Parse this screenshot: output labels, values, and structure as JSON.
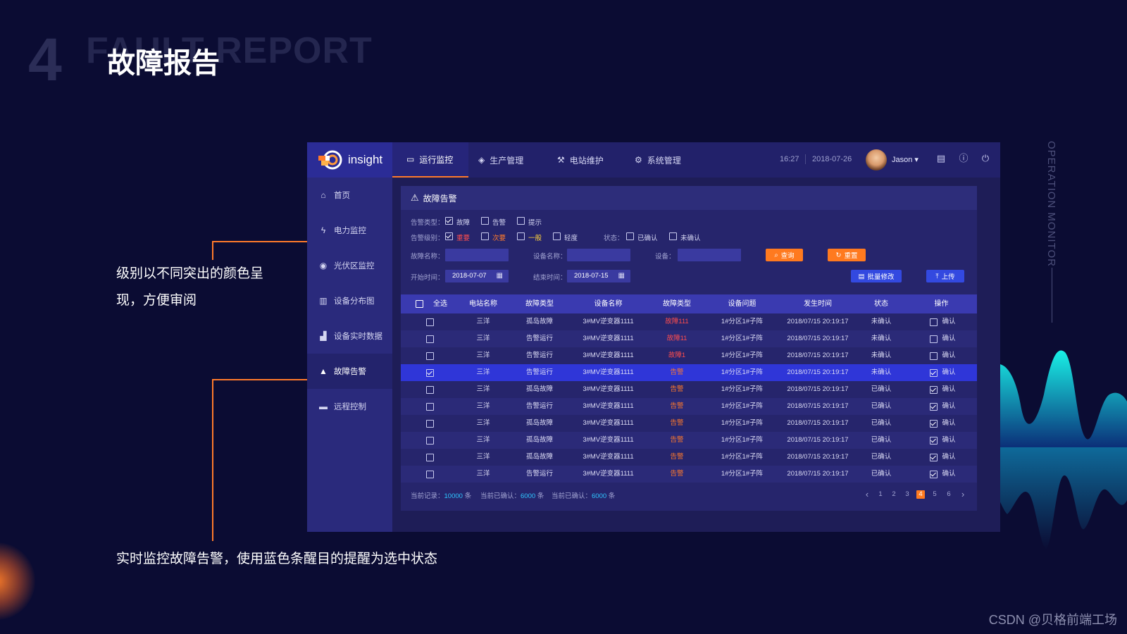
{
  "slide": {
    "number": "4",
    "title_en": "FAULT REPORT",
    "title_cn": "故障报告",
    "side_vertical": "OPERATION MONITOR",
    "credit": "CSDN @贝格前端工场"
  },
  "notes": {
    "note1": "级别以不同突出的颜色呈现，方便审阅",
    "note2": "实时监控故障告警，使用蓝色条醒目的提醒为选中状态"
  },
  "app": {
    "logo_text": "insight",
    "nav": [
      "运行监控",
      "生产管理",
      "电站维护",
      "系统管理"
    ],
    "time": "16:27",
    "date": "2018-07-26",
    "user": "Jason ▾",
    "sidebar": [
      "首页",
      "电力监控",
      "光伏区监控",
      "设备分布图",
      "设备实时数据",
      "故障告警",
      "远程控制"
    ],
    "panel_title": "故障告警",
    "filters": {
      "alarm_type_label": "告警类型：",
      "alarm_types": [
        "故障",
        "告警",
        "提示"
      ],
      "alarm_level_label": "告警级别：",
      "alarm_levels": [
        "重要",
        "次要",
        "一般",
        "轻度"
      ],
      "status_label": "状态：",
      "statuses": [
        "已确认",
        "未确认"
      ],
      "fault_name_label": "故障名称：",
      "device_name_label": "设备名称：",
      "device_label": "设备：",
      "query_btn": "查询",
      "reset_btn": "重置",
      "start_label": "开始时间：",
      "start_value": "2018-07-07",
      "end_label": "结束时间：",
      "end_value": "2018-07-15",
      "batch_btn": "批量修改",
      "upload_btn": "上传"
    },
    "table": {
      "select_all": "全选",
      "headers": [
        "电站名称",
        "故障类型",
        "设备名称",
        "故障类型",
        "设备问题",
        "发生时间",
        "状态",
        "操作"
      ],
      "rows": [
        {
          "station": "三洋",
          "ftype": "孤岛故障",
          "device": "3#MV逆变器1111",
          "level": "故障111",
          "level_color": "red",
          "issue": "1#分区1#子阵",
          "time": "2018/07/15 20:19:17",
          "status": "未确认",
          "checked": false,
          "confirm_checked": false,
          "action": "确认"
        },
        {
          "station": "三洋",
          "ftype": "告警运行",
          "device": "3#MV逆变器1111",
          "level": "故障11",
          "level_color": "red",
          "issue": "1#分区1#子阵",
          "time": "2018/07/15 20:19:17",
          "status": "未确认",
          "checked": false,
          "confirm_checked": false,
          "action": "确认"
        },
        {
          "station": "三洋",
          "ftype": "告警运行",
          "device": "3#MV逆变器1111",
          "level": "故障1",
          "level_color": "red",
          "issue": "1#分区1#子阵",
          "time": "2018/07/15 20:19:17",
          "status": "未确认",
          "checked": false,
          "confirm_checked": false,
          "action": "确认"
        },
        {
          "station": "三洋",
          "ftype": "告警运行",
          "device": "3#MV逆变器1111",
          "level": "告警",
          "level_color": "orange",
          "issue": "1#分区1#子阵",
          "time": "2018/07/15 20:19:17",
          "status": "未确认",
          "checked": true,
          "confirm_checked": true,
          "action": "确认",
          "selected": true
        },
        {
          "station": "三洋",
          "ftype": "孤岛故障",
          "device": "3#MV逆变器1111",
          "level": "告警",
          "level_color": "orange",
          "issue": "1#分区1#子阵",
          "time": "2018/07/15 20:19:17",
          "status": "已确认",
          "checked": false,
          "confirm_checked": true,
          "action": "确认"
        },
        {
          "station": "三洋",
          "ftype": "告警运行",
          "device": "3#MV逆变器1111",
          "level": "告警",
          "level_color": "orange",
          "issue": "1#分区1#子阵",
          "time": "2018/07/15 20:19:17",
          "status": "已确认",
          "checked": false,
          "confirm_checked": true,
          "action": "确认"
        },
        {
          "station": "三洋",
          "ftype": "孤岛故障",
          "device": "3#MV逆变器1111",
          "level": "告警",
          "level_color": "orange",
          "issue": "1#分区1#子阵",
          "time": "2018/07/15 20:19:17",
          "status": "已确认",
          "checked": false,
          "confirm_checked": true,
          "action": "确认"
        },
        {
          "station": "三洋",
          "ftype": "孤岛故障",
          "device": "3#MV逆变器1111",
          "level": "告警",
          "level_color": "orange",
          "issue": "1#分区1#子阵",
          "time": "2018/07/15 20:19:17",
          "status": "已确认",
          "checked": false,
          "confirm_checked": true,
          "action": "确认"
        },
        {
          "station": "三洋",
          "ftype": "孤岛故障",
          "device": "3#MV逆变器1111",
          "level": "告警",
          "level_color": "orange",
          "issue": "1#分区1#子阵",
          "time": "2018/07/15 20:19:17",
          "status": "已确认",
          "checked": false,
          "confirm_checked": true,
          "action": "确认"
        },
        {
          "station": "三洋",
          "ftype": "告警运行",
          "device": "3#MV逆变器1111",
          "level": "告警",
          "level_color": "orange",
          "issue": "1#分区1#子阵",
          "time": "2018/07/15 20:19:17",
          "status": "已确认",
          "checked": false,
          "confirm_checked": true,
          "action": "确认"
        }
      ]
    },
    "footer": {
      "records_label": "当前记录：",
      "records_value": "10000",
      "confirmed_label": "当前已确认：",
      "confirmed_value": "6000",
      "confirmed2_label": "当前已确认：",
      "confirmed2_value": "6000",
      "unit": "条",
      "pages": [
        "1",
        "2",
        "3",
        "4",
        "5",
        "6"
      ],
      "current_page": "4",
      "prev": "‹",
      "next": "›"
    }
  },
  "colors": {
    "background": "#0b0c33",
    "accent_orange": "#ff7a2b",
    "selected_row": "#2f36d8",
    "level_red": "#ff4d4d",
    "highlight_blue": "#2fc6ff",
    "wave": "#19e7e0"
  }
}
